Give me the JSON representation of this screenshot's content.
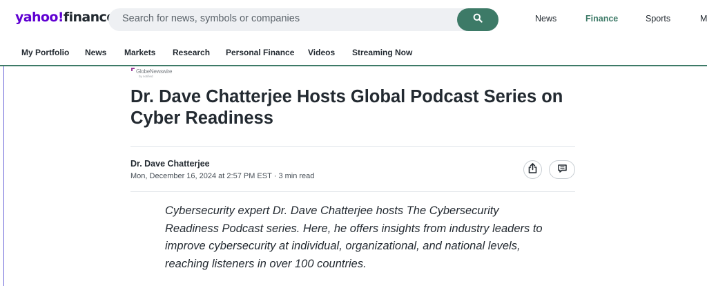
{
  "header": {
    "logo_brand": "yahoo!",
    "logo_section": "finance",
    "search_placeholder": "Search for news, symbols or companies",
    "nav": [
      {
        "label": "News"
      },
      {
        "label": "Finance",
        "active": true
      },
      {
        "label": "Sports"
      },
      {
        "label": "M"
      }
    ]
  },
  "subnav": {
    "items": [
      {
        "label": "My Portfolio"
      },
      {
        "label": "News"
      },
      {
        "label": "Markets"
      },
      {
        "label": "Research"
      },
      {
        "label": "Personal Finance"
      },
      {
        "label": "Videos"
      },
      {
        "label": "Streaming Now"
      }
    ]
  },
  "article": {
    "source_name": "GlobeNewswire",
    "source_sub": "by notified",
    "headline": "Dr. Dave Chatterjee Hosts Global Podcast Series on Cyber Readiness",
    "author": "Dr. Dave Chatterjee",
    "date": "Mon, December 16, 2024 at 2:57 PM EST",
    "read_time": "3 min read",
    "summary": "Cybersecurity expert Dr. Dave Chatterjee hosts The Cybersecurity Readiness Podcast series. Here, he offers insights from industry leaders to improve cybersecurity at individual, organizational, and national levels, reaching listeners in over 100 countries."
  },
  "colors": {
    "brand_purple": "#6001d2",
    "finance_green": "#3d7a67",
    "text": "#232a31"
  },
  "icons": {
    "search": "search-icon",
    "share": "share-icon",
    "comment": "comment-icon"
  }
}
